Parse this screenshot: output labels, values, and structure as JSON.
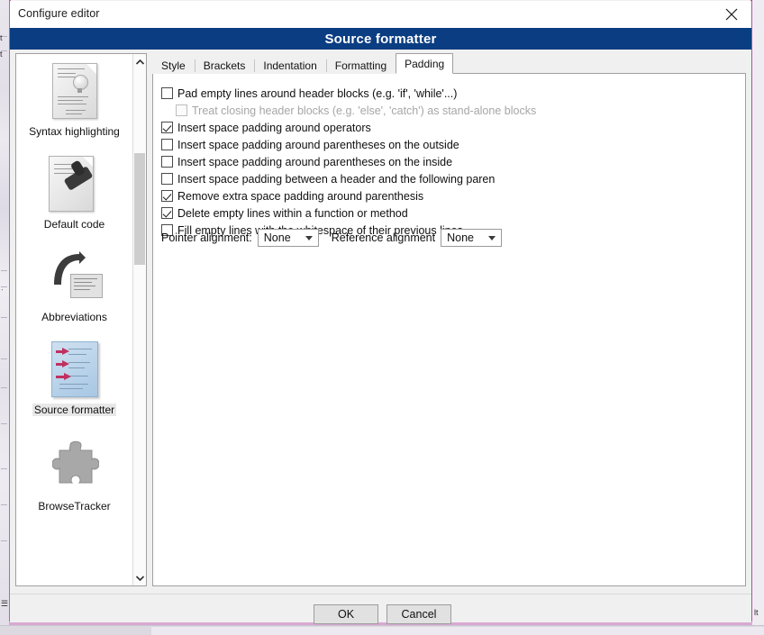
{
  "window": {
    "title": "Configure editor",
    "close_icon": "close-x-icon",
    "banner_title": "Source formatter",
    "banner_color": "#0b3d82"
  },
  "sidebar": {
    "scroll_up_icon": "chevron-up-icon",
    "scroll_down_icon": "chevron-down-icon",
    "items": [
      {
        "label": "Syntax highlighting",
        "icon": "syntax-highlighting-icon",
        "selected": false
      },
      {
        "label": "Default code",
        "icon": "default-code-stamp-icon",
        "selected": false
      },
      {
        "label": "Abbreviations",
        "icon": "abbreviations-arrow-icon",
        "selected": false
      },
      {
        "label": "Source formatter",
        "icon": "source-formatter-icon",
        "selected": true
      },
      {
        "label": "BrowseTracker",
        "icon": "browsetracker-puzzle-icon",
        "selected": false
      }
    ]
  },
  "tabs": [
    {
      "label": "Style",
      "active": false
    },
    {
      "label": "Brackets",
      "active": false
    },
    {
      "label": "Indentation",
      "active": false
    },
    {
      "label": "Formatting",
      "active": false
    },
    {
      "label": "Padding",
      "active": true
    }
  ],
  "padding_panel": {
    "options": [
      {
        "label": "Pad empty lines around header blocks (e.g. 'if', 'while'...)",
        "checked": false,
        "enabled": true,
        "indent": false
      },
      {
        "label": "Treat closing header blocks (e.g. 'else', 'catch') as stand-alone blocks",
        "checked": false,
        "enabled": false,
        "indent": true
      },
      {
        "label": "Insert space padding around operators",
        "checked": true,
        "enabled": true,
        "indent": false
      },
      {
        "label": "Insert space padding around parentheses on the outside",
        "checked": false,
        "enabled": true,
        "indent": false
      },
      {
        "label": "Insert space padding around parentheses on the inside",
        "checked": false,
        "enabled": true,
        "indent": false
      },
      {
        "label": "Insert space padding between a header and the following paren",
        "checked": false,
        "enabled": true,
        "indent": false
      },
      {
        "label": "Remove extra space padding around parenthesis",
        "checked": true,
        "enabled": true,
        "indent": false
      },
      {
        "label": "Delete empty lines within a function or method",
        "checked": true,
        "enabled": true,
        "indent": false
      },
      {
        "label": "Fill empty lines with the whitespace of their previous lines",
        "checked": false,
        "enabled": true,
        "indent": false
      }
    ],
    "pointer_alignment": {
      "label": "Pointer alignment:",
      "value": "None"
    },
    "reference_alignment": {
      "label": "Reference alignment",
      "value": "None"
    }
  },
  "footer": {
    "ok_label": "OK",
    "cancel_label": "Cancel"
  },
  "background": {
    "left_glyph": "t",
    "left_glyph2": "t",
    "left_glyph3": "ᐧ",
    "right_glyph": "lt"
  }
}
